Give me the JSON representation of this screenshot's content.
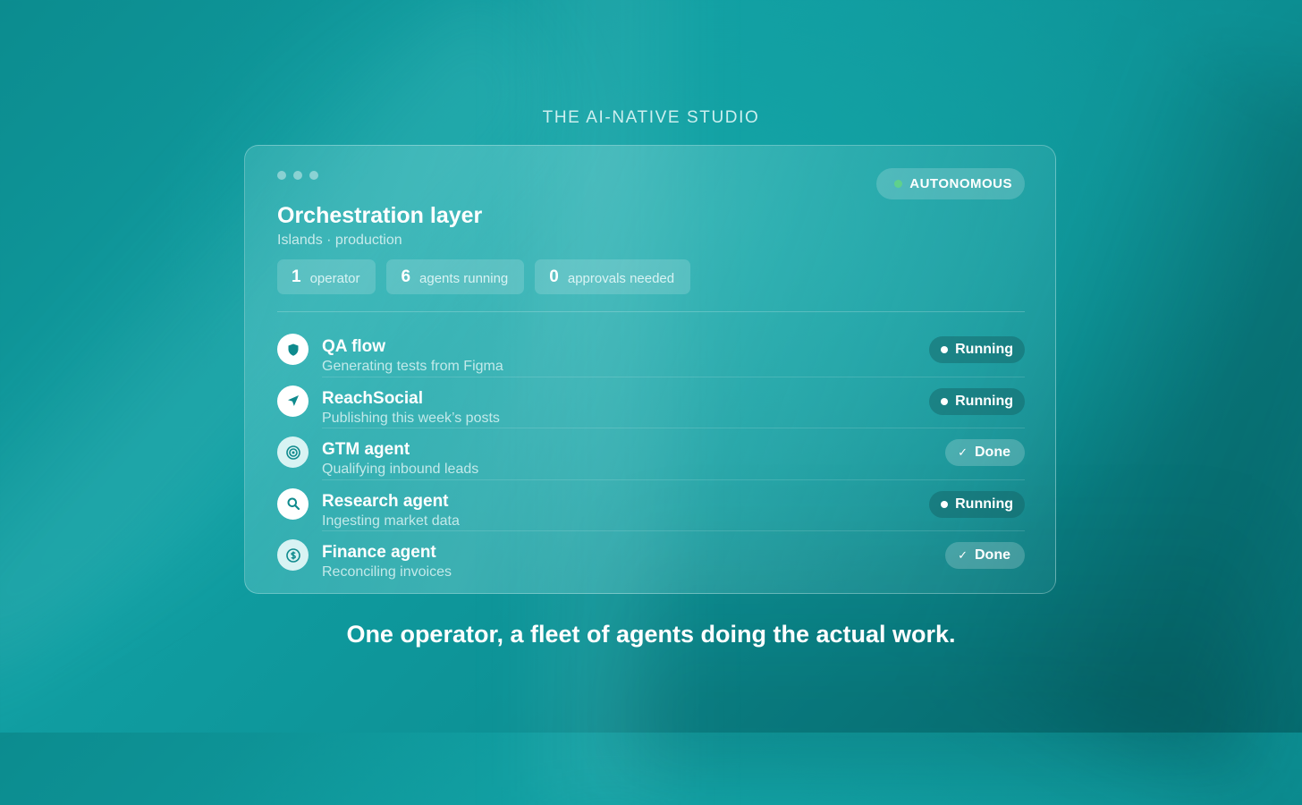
{
  "eyebrow": "THE AI-NATIVE STUDIO",
  "card": {
    "title": "Orchestration layer",
    "subtitle": "Islands · production",
    "status": {
      "label": "AUTONOMOUS",
      "color": "#5fd18c"
    },
    "stats": [
      {
        "value": "1",
        "label": "operator"
      },
      {
        "value": "6",
        "label": "agents running"
      },
      {
        "value": "0",
        "label": "approvals needed"
      }
    ],
    "agents": [
      {
        "name": "QA flow",
        "description": "Generating tests from Figma",
        "status": "Running",
        "icon": "shield-icon"
      },
      {
        "name": "ReachSocial",
        "description": "Publishing this week’s posts",
        "status": "Running",
        "icon": "send-arrow-icon"
      },
      {
        "name": "GTM agent",
        "description": "Qualifying inbound leads",
        "status": "Done",
        "icon": "target-icon"
      },
      {
        "name": "Research agent",
        "description": "Ingesting market data",
        "status": "Running",
        "icon": "search-icon"
      },
      {
        "name": "Finance agent",
        "description": "Reconciling invoices",
        "status": "Done",
        "icon": "dollar-coin-icon"
      }
    ]
  },
  "tagline": "One operator, a fleet of agents doing the actual work.",
  "colors": {
    "accent": "#0e8a8d",
    "status_green": "#5fd18c"
  }
}
